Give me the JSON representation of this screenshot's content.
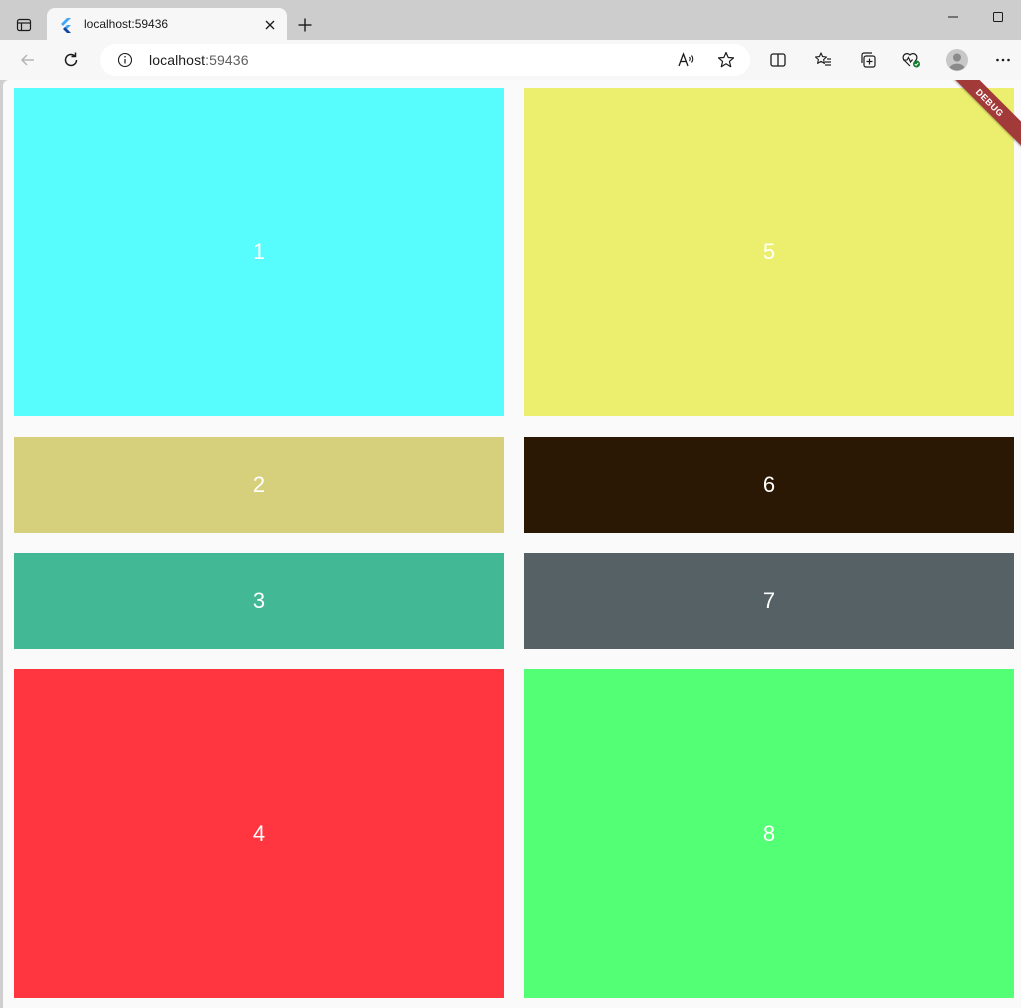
{
  "browser": {
    "tab": {
      "title": "localhost:59436"
    },
    "address": {
      "host": "localhost",
      "port": ":59436"
    }
  },
  "app": {
    "debug_banner": "DEBUG",
    "tiles": [
      {
        "label": "1",
        "color": "#57fcfd"
      },
      {
        "label": "2",
        "color": "#d6d07d"
      },
      {
        "label": "3",
        "color": "#43b894"
      },
      {
        "label": "4",
        "color": "#ff3540"
      },
      {
        "label": "5",
        "color": "#ecef6e"
      },
      {
        "label": "6",
        "color": "#2a1805"
      },
      {
        "label": "7",
        "color": "#566166"
      },
      {
        "label": "8",
        "color": "#53ff75"
      }
    ]
  }
}
